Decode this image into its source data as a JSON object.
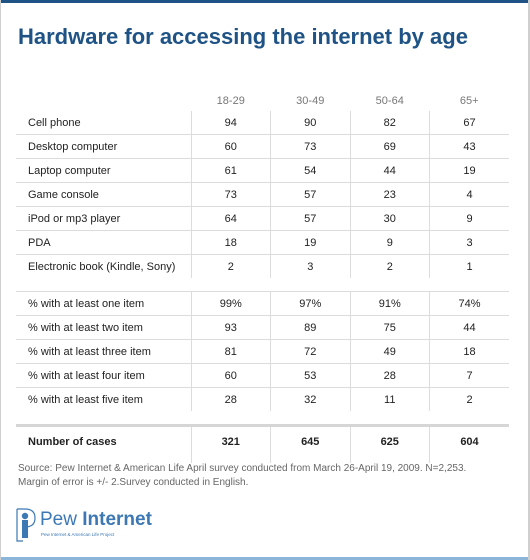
{
  "title": "Hardware for accessing the internet by age",
  "chart_data": {
    "type": "table",
    "title": "Hardware for accessing the internet by age",
    "columns": [
      "",
      "18-29",
      "30-49",
      "50-64",
      "65+"
    ],
    "categories": [
      "18-29",
      "30-49",
      "50-64",
      "65+"
    ],
    "sections": [
      {
        "rows": [
          {
            "label": "Cell phone",
            "values": [
              "94",
              "90",
              "82",
              "67"
            ]
          },
          {
            "label": "Desktop computer",
            "values": [
              "60",
              "73",
              "69",
              "43"
            ]
          },
          {
            "label": "Laptop computer",
            "values": [
              "61",
              "54",
              "44",
              "19"
            ]
          },
          {
            "label": "Game console",
            "values": [
              "73",
              "57",
              "23",
              "4"
            ]
          },
          {
            "label": "iPod or mp3 player",
            "values": [
              "64",
              "57",
              "30",
              "9"
            ]
          },
          {
            "label": "PDA",
            "values": [
              "18",
              "19",
              "9",
              "3"
            ]
          },
          {
            "label": "Electronic book (Kindle, Sony)",
            "values": [
              "2",
              "3",
              "2",
              "1"
            ]
          }
        ]
      },
      {
        "rows": [
          {
            "label": "% with at least one item",
            "values": [
              "99%",
              "97%",
              "91%",
              "74%"
            ]
          },
          {
            "label": "% with at least two item",
            "values": [
              "93",
              "89",
              "75",
              "44"
            ]
          },
          {
            "label": "% with at least three item",
            "values": [
              "81",
              "72",
              "49",
              "18"
            ]
          },
          {
            "label": "% with at least four item",
            "values": [
              "60",
              "53",
              "28",
              "7"
            ]
          },
          {
            "label": "% with at least five item",
            "values": [
              "28",
              "32",
              "11",
              "2"
            ]
          }
        ]
      }
    ],
    "total": {
      "label": "Number of cases",
      "values": [
        "321",
        "645",
        "625",
        "604"
      ]
    }
  },
  "source": {
    "line1": "Source: Pew Internet & American Life April survey conducted from March 26-April 19, 2009. N=2,253.",
    "line2": "Margin of error is +/- 2.Survey conducted in English."
  },
  "logo": {
    "word1": "Pew",
    "word2": "Internet",
    "subtitle": "Pew Internet & American Life Project",
    "color": "#3c78b4"
  },
  "colors": {
    "title": "#1f5385",
    "top_bar": "#1f5385",
    "bottom_bar": "#8cb6d9"
  }
}
